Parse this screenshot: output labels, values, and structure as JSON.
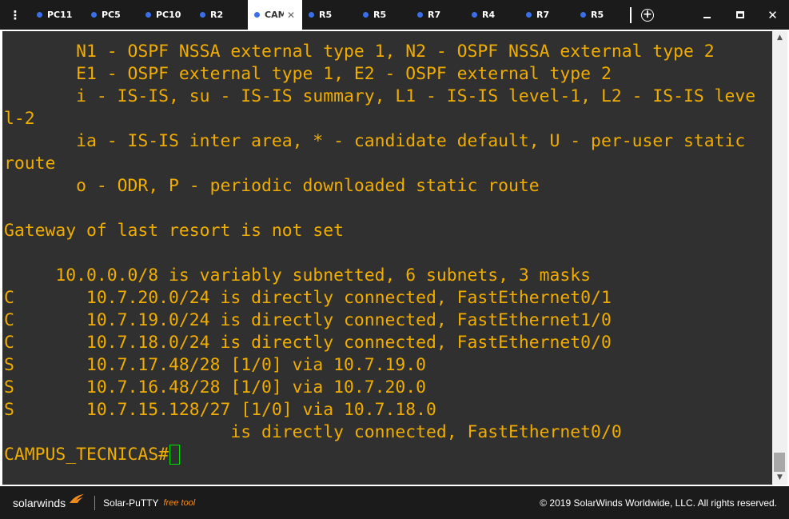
{
  "tabs": [
    {
      "label": "PC11",
      "active": false
    },
    {
      "label": "PC5",
      "active": false
    },
    {
      "label": "PC10",
      "active": false
    },
    {
      "label": "R2",
      "active": false
    },
    {
      "label": "CAMPUS_TECNICAS",
      "active": true
    },
    {
      "label": "R5",
      "active": false
    },
    {
      "label": "R5",
      "active": false
    },
    {
      "label": "R7",
      "active": false
    },
    {
      "label": "R4",
      "active": false
    },
    {
      "label": "R7",
      "active": false
    },
    {
      "label": "R5",
      "active": false
    }
  ],
  "tab_dot_color": "#3b6fe8",
  "terminal": {
    "lines": [
      "       N1 - OSPF NSSA external type 1, N2 - OSPF NSSA external type 2",
      "       E1 - OSPF external type 1, E2 - OSPF external type 2",
      "       i - IS-IS, su - IS-IS summary, L1 - IS-IS level-1, L2 - IS-IS leve",
      "l-2",
      "       ia - IS-IS inter area, * - candidate default, U - per-user static",
      "route",
      "       o - ODR, P - periodic downloaded static route",
      "",
      "Gateway of last resort is not set",
      "",
      "     10.0.0.0/8 is variably subnetted, 6 subnets, 3 masks",
      "C       10.7.20.0/24 is directly connected, FastEthernet0/1",
      "C       10.7.19.0/24 is directly connected, FastEthernet1/0",
      "C       10.7.18.0/24 is directly connected, FastEthernet0/0",
      "S       10.7.17.48/28 [1/0] via 10.7.19.0",
      "S       10.7.16.48/28 [1/0] via 10.7.20.0",
      "S       10.7.15.128/27 [1/0] via 10.7.18.0",
      "                      is directly connected, FastEthernet0/0"
    ],
    "prompt": "CAMPUS_TECNICAS#",
    "text_color": "#f0ad00",
    "background": "#303030",
    "cursor_color": "#00e000"
  },
  "footer": {
    "brand": "solarwinds",
    "product": "Solar-PuTTY",
    "tag": "free tool",
    "copyright": "© 2019 SolarWinds Worldwide, LLC. All rights reserved."
  }
}
